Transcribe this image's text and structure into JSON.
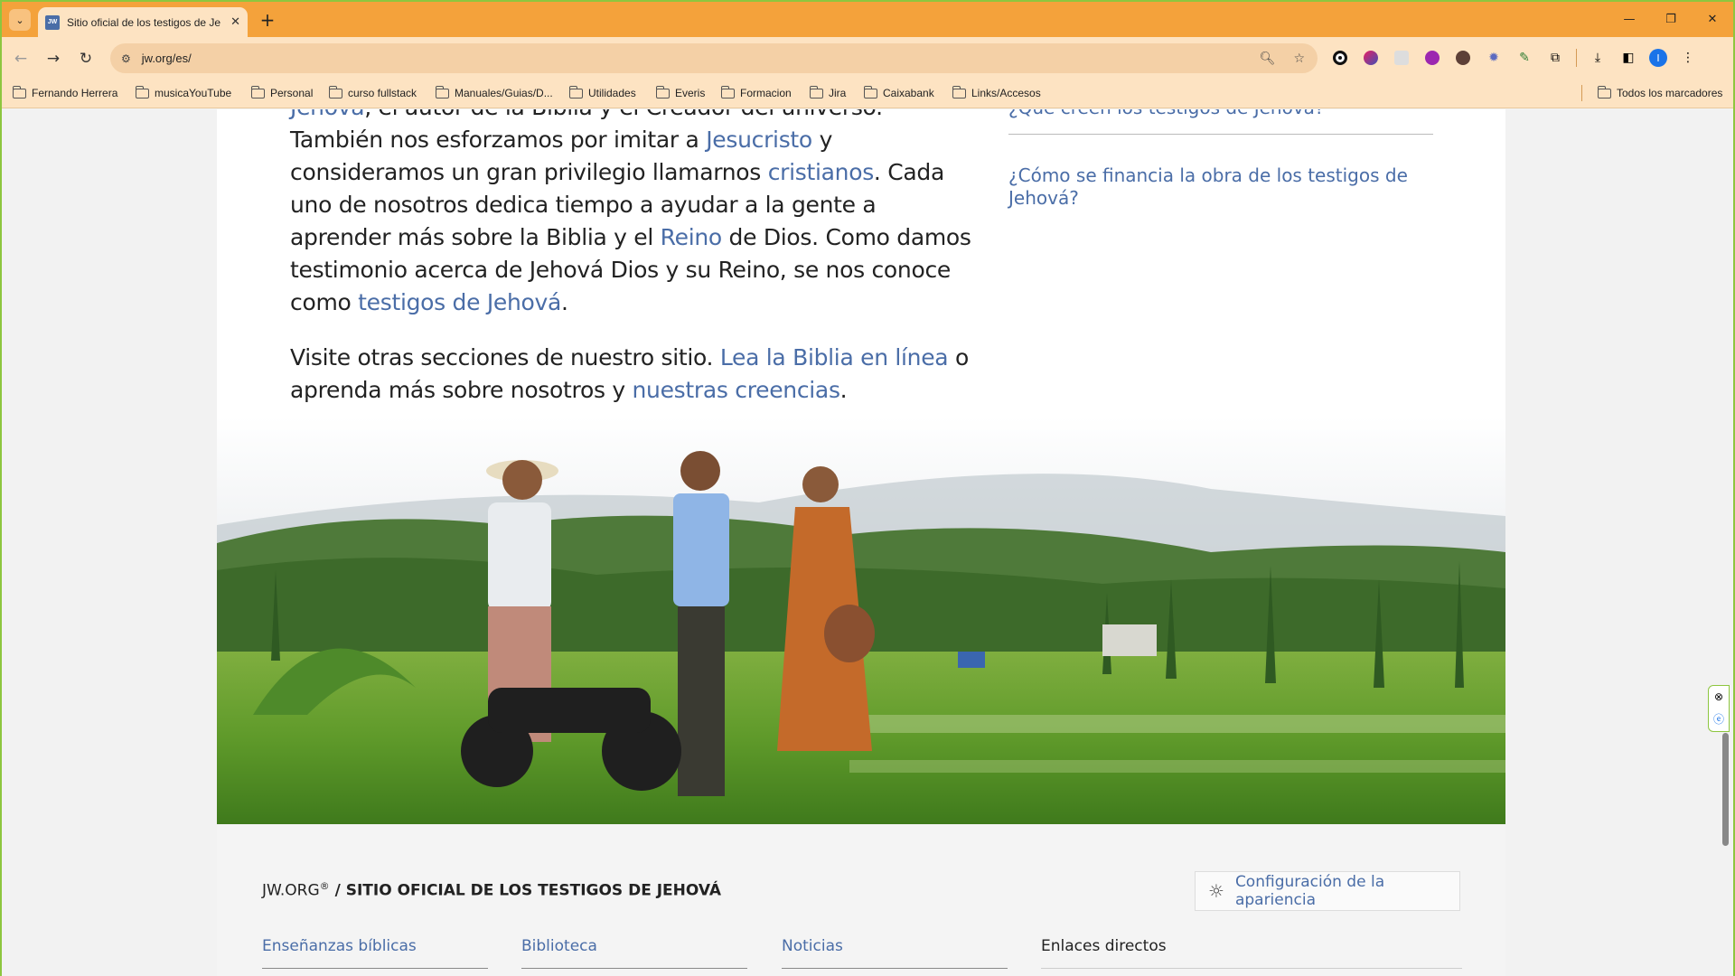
{
  "browser": {
    "tab_title": "Sitio oficial de los testigos de Je",
    "favicon_text": "JW",
    "url": "jw.org/es/",
    "bookmarks": [
      "Fernando Herrera",
      "musicaYouTube",
      "Personal",
      "curso fullstack",
      "Manuales/Guias/D...",
      "Utilidades",
      "Everis",
      "Formacion",
      "Jira",
      "Caixabank",
      "Links/Accesos"
    ],
    "all_bookmarks": "Todos los marcadores",
    "profile_initial": "I"
  },
  "article": {
    "p1": {
      "a1": "Jehová",
      "t1": ", el autor de la Biblia y el Creador del universo. También nos esforzamos por imitar a ",
      "a2": "Jesucristo",
      "t2": " y consideramos un gran privilegio llamarnos ",
      "a3": "cristianos",
      "t3": ". Cada uno de nosotros dedica tiempo a ayudar a la gente a aprender más sobre la Biblia y el ",
      "a4": "Reino",
      "t4": " de Dios. Como damos testimonio acerca de Jehová Dios y su Reino, se nos conoce como ",
      "a5": "testigos de Jehová",
      "t5": "."
    },
    "p2": {
      "t1": "Visite otras secciones de nuestro sitio. ",
      "a1": "Lea la Biblia en línea",
      "t2": " o aprenda más sobre nosotros y ",
      "a2": "nuestras creencias",
      "t3": "."
    }
  },
  "sidebar": {
    "q1": "¿Qué creen los testigos de Jehová?",
    "q2": "¿Cómo se financia la obra de los testigos de Jehová?"
  },
  "footer": {
    "brand": "JW.ORG",
    "reg": "®",
    "title": " / SITIO OFICIAL DE LOS TESTIGOS DE JEHOVÁ",
    "appearance": "Configuración de la apariencia",
    "columns": [
      "Enseñanzas bíblicas",
      "Biblioteca",
      "Noticias",
      "Enlaces directos"
    ]
  }
}
